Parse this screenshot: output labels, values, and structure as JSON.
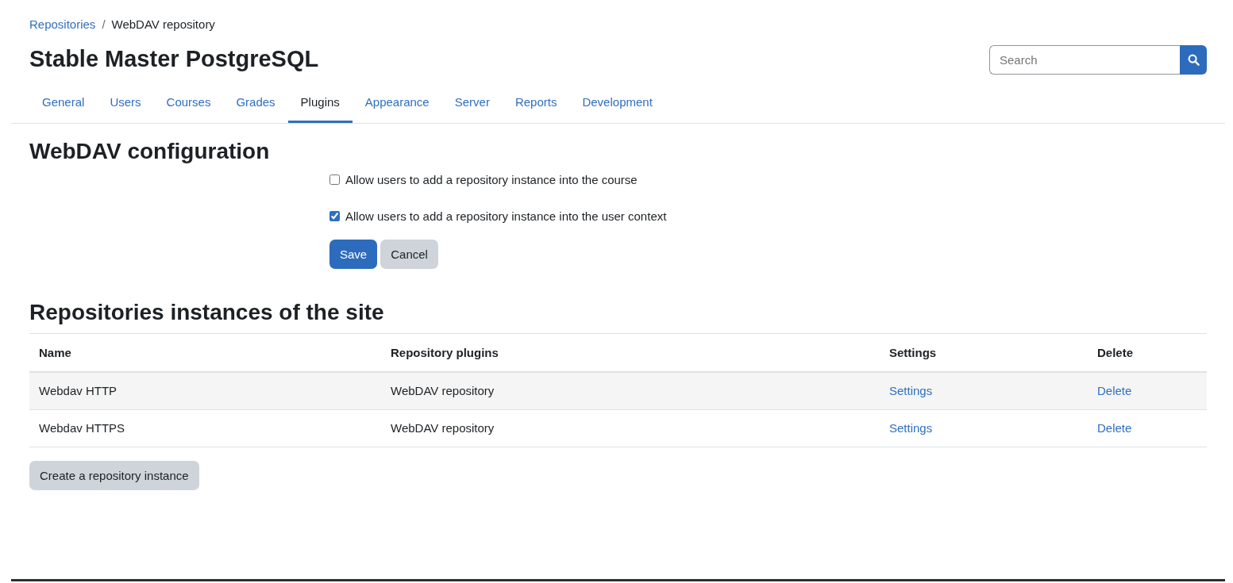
{
  "breadcrumb_separator": "/",
  "breadcrumb": [
    {
      "label": "Repositories",
      "link": true
    },
    {
      "label": "WebDAV repository",
      "link": false
    }
  ],
  "site_title": "Stable Master PostgreSQL",
  "search": {
    "placeholder": "Search"
  },
  "tabs": [
    {
      "label": "General",
      "selected": false
    },
    {
      "label": "Users",
      "selected": false
    },
    {
      "label": "Courses",
      "selected": false
    },
    {
      "label": "Grades",
      "selected": false
    },
    {
      "label": "Plugins",
      "selected": true
    },
    {
      "label": "Appearance",
      "selected": false
    },
    {
      "label": "Server",
      "selected": false
    },
    {
      "label": "Reports",
      "selected": false
    },
    {
      "label": "Development",
      "selected": false
    }
  ],
  "config": {
    "heading": "WebDAV configuration",
    "options": [
      {
        "label": "Allow users to add a repository instance into the course",
        "checked": false
      },
      {
        "label": "Allow users to add a repository instance into the user context",
        "checked": true
      }
    ],
    "buttons": [
      {
        "label": "Save",
        "kind": "primary"
      },
      {
        "label": "Cancel",
        "kind": "secondary"
      }
    ]
  },
  "instances": {
    "heading": "Repositories instances of the site",
    "columns": [
      "Name",
      "Repository plugins",
      "Settings",
      "Delete"
    ],
    "rows": [
      {
        "name": "Webdav HTTP",
        "plugin": "WebDAV repository",
        "settings": "Settings",
        "delete": "Delete"
      },
      {
        "name": "Webdav HTTPS",
        "plugin": "WebDAV repository",
        "settings": "Settings",
        "delete": "Delete"
      }
    ],
    "create_button": "Create a repository instance"
  }
}
